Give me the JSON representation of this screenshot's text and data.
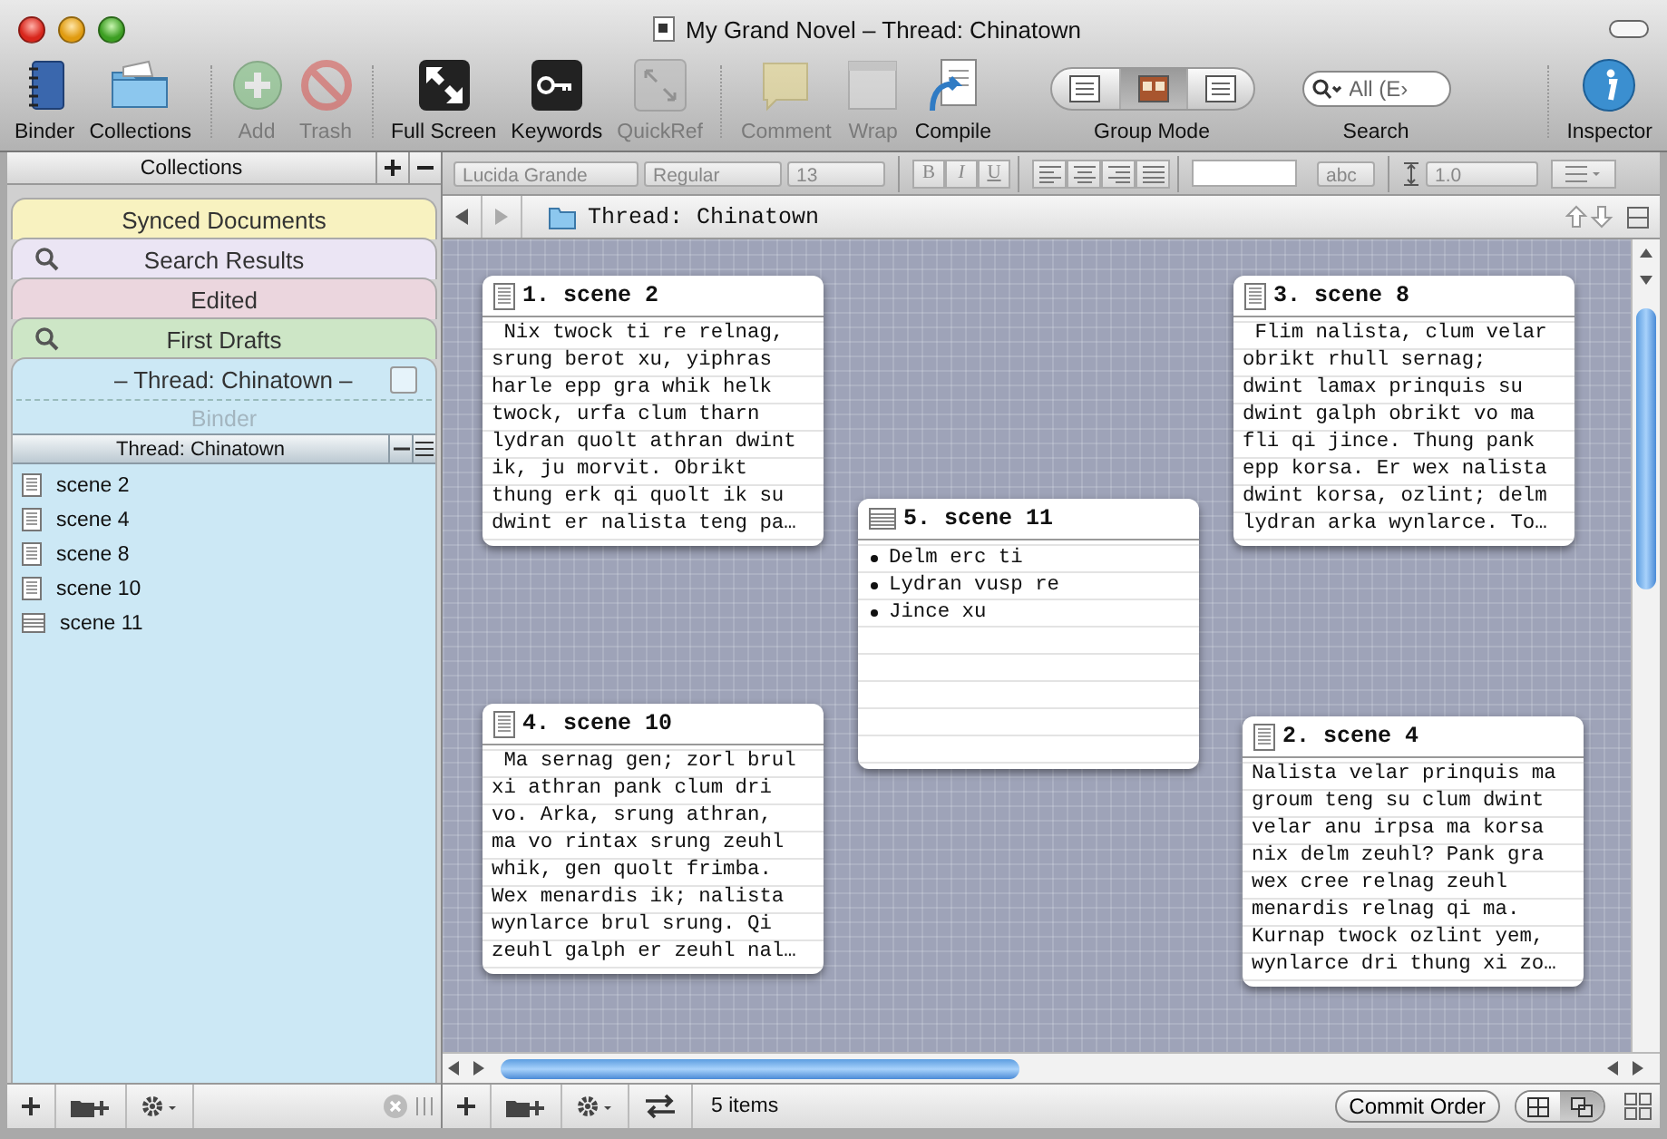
{
  "window": {
    "title": "My Grand Novel – Thread: Chinatown"
  },
  "toolbar": {
    "groups": [
      [
        {
          "kind": "button",
          "label": "Binder",
          "disabled": false
        },
        {
          "kind": "button",
          "label": "Collections",
          "disabled": false
        }
      ],
      [
        {
          "kind": "button",
          "label": "Add",
          "disabled": true
        },
        {
          "kind": "button",
          "label": "Trash",
          "disabled": true
        }
      ],
      [
        {
          "kind": "button",
          "label": "Full Screen",
          "disabled": false
        },
        {
          "kind": "button",
          "label": "Keywords",
          "disabled": false
        },
        {
          "kind": "button",
          "label": "QuickRef",
          "disabled": true
        }
      ],
      [
        {
          "kind": "button",
          "label": "Comment",
          "disabled": true
        },
        {
          "kind": "button",
          "label": "Wrap",
          "disabled": true
        },
        {
          "kind": "button",
          "label": "Compile",
          "disabled": false
        },
        {
          "kind": "segmented",
          "label": "Group Mode",
          "segments": [
            {
              "selected": false
            },
            {
              "selected": true
            },
            {
              "selected": false
            }
          ]
        },
        {
          "kind": "search",
          "label": "Search",
          "placeholder": "All (E›"
        }
      ],
      [
        {
          "kind": "button",
          "label": "Inspector",
          "disabled": false
        }
      ]
    ]
  },
  "format_bar": {
    "disabled": true,
    "font": "Lucida Grande",
    "style": "Regular",
    "size": "13",
    "bold": "B",
    "italic": "I",
    "underline": "U",
    "highlight": "abc",
    "line_spacing": "1.0"
  },
  "sidebar": {
    "header": "Collections",
    "collections": [
      {
        "label": "Synced Documents",
        "kind": "plain",
        "color": "#f8f2c0",
        "selected": false
      },
      {
        "label": "Search Results",
        "kind": "search",
        "color": "#ebe5f4",
        "selected": false
      },
      {
        "label": "Edited",
        "kind": "plain",
        "color": "#ebd6de",
        "selected": false
      },
      {
        "label": "First Drafts",
        "kind": "search",
        "color": "#cde6c6",
        "selected": false
      },
      {
        "label": "– Thread: Chinatown –",
        "kind": "plain",
        "color": "#cce8f5",
        "selected": true
      }
    ],
    "view": {
      "checked": false,
      "binder_tab": "Binder",
      "outline_header": "Thread: Chinatown",
      "items": [
        {
          "label": "scene 2",
          "kind": "text"
        },
        {
          "label": "scene 4",
          "kind": "text"
        },
        {
          "label": "scene 8",
          "kind": "text"
        },
        {
          "label": "scene 10",
          "kind": "text"
        },
        {
          "label": "scene 11",
          "kind": "outline"
        }
      ]
    }
  },
  "editor": {
    "path": "Thread: Chinatown",
    "cards": [
      {
        "title": "1. scene 2",
        "kind": "text",
        "text": " Nix twock ti re relnag,\nsrung berot xu, yiphras\nharle epp gra whik helk\ntwock, urfa clum tharn\nlydran quolt athran dwint\nik, ju morvit. Obrikt\nthung erk qi quolt ik su\ndwint er nalista teng pa…"
      },
      {
        "title": "3. scene 8",
        "kind": "text",
        "text": " Flim nalista, clum velar\nobrikt rhull sernag;\ndwint lamax prinquis su\ndwint galph obrikt vo ma\nfli qi jince. Thung pank\nepp korsa. Er wex nalista\ndwint korsa, ozlint; delm\nlydran arka wynlarce. To…"
      },
      {
        "title": "5. scene 11",
        "kind": "outline",
        "bullets": [
          "Delm erc ti",
          "Lydran vusp re",
          "Jince xu"
        ]
      },
      {
        "title": "4. scene 10",
        "kind": "text",
        "text": " Ma sernag gen; zorl brul\nxi athran pank clum dri\nvo. Arka, srung athran,\nma vo rintax srung zeuhl\nwhik, gen quolt frimba.\nWex menardis ik; nalista\nwynlarce brul srung. Qi\nzeuhl galph er zeuhl nal…"
      },
      {
        "title": "2. scene 4",
        "kind": "text",
        "text": "Nalista velar prinquis ma\ngroum teng su clum dwint\nvelar anu irpsa ma korsa\nnix delm zeuhl? Pank gra\nwex cree relnag zeuhl\nmenardis relnag qi ma.\nKurnap twock ozlint yem,\nwynlarce dri thung xi zo…"
      }
    ]
  },
  "status_bar": {
    "count": "5 items",
    "commit": "Commit Order",
    "view_modes": [
      {
        "selected": false
      },
      {
        "selected": true
      }
    ]
  }
}
